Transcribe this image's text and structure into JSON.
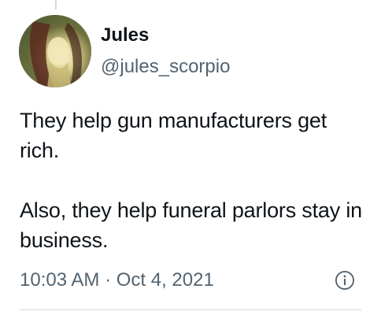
{
  "tweet": {
    "author": {
      "display_name": "Jules",
      "handle": "@jules_scorpio"
    },
    "text": "They help gun manufacturers get rich.\n\nAlso, they help funeral parlors stay in business.",
    "timestamp": "10:03 AM · Oct 4, 2021"
  },
  "icons": {
    "info": "info-circle-icon"
  },
  "colors": {
    "text_primary": "#0f1419",
    "text_secondary": "#536471",
    "divider": "#cfd9de"
  }
}
